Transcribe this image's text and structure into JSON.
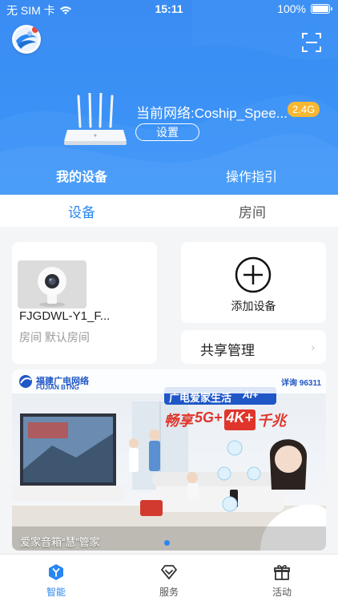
{
  "status_bar": {
    "carrier": "无 SIM 卡",
    "time": "15:11",
    "battery": "100%"
  },
  "header": {
    "network_label": "当前网络:Coship_Spee...",
    "band": "2.4G",
    "settings_label": "设置"
  },
  "top_tabs": [
    {
      "label": "我的设备",
      "active": true
    },
    {
      "label": "操作指引",
      "active": false
    }
  ],
  "sub_tabs": [
    {
      "label": "设备",
      "active": true
    },
    {
      "label": "房间",
      "active": false
    }
  ],
  "device": {
    "name": "FJGDWL-Y1_F...",
    "room": "房间 默认房间"
  },
  "add_device": {
    "label": "添加设备"
  },
  "share": {
    "label": "共享管理",
    "chevron": "›"
  },
  "banner": {
    "brand_cn": "福建广电网络",
    "brand_en": "FUJIAN BTNG",
    "hotline": "详询 96311",
    "headline": "广电爱家生活",
    "ai_tag": "AI+",
    "slogan_prefix": "畅享",
    "slogan_5g": "5G+",
    "slogan_4k": "4K+",
    "slogan_suffix": "千兆",
    "caption": "爱家音箱“慧”管家"
  },
  "bottom_nav": [
    {
      "label": "智能",
      "icon": "smart-home-icon",
      "active": true
    },
    {
      "label": "服务",
      "icon": "diamond-icon",
      "active": false
    },
    {
      "label": "活动",
      "icon": "gift-icon",
      "active": false
    }
  ],
  "colors": {
    "primary": "#2a86f2",
    "hero": "#3b91f5",
    "band_badge": "#f6b733"
  }
}
